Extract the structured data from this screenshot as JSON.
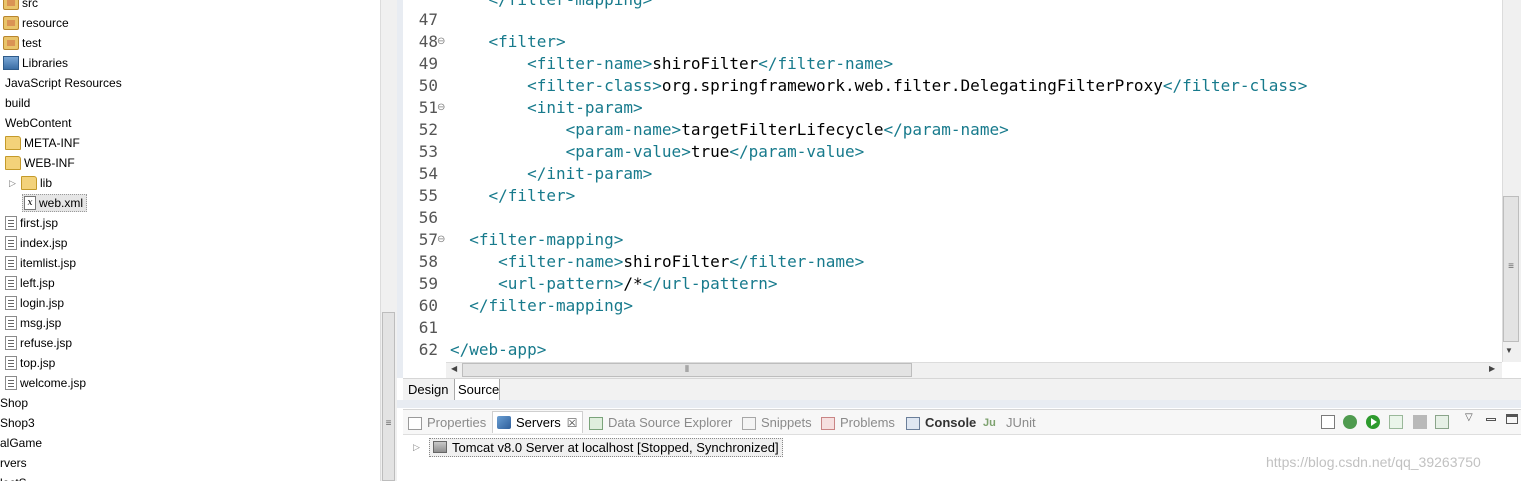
{
  "project_tree": {
    "items": [
      {
        "label": "src",
        "icon": "package-folder-icon"
      },
      {
        "label": "resource",
        "icon": "package-folder-icon"
      },
      {
        "label": "test",
        "icon": "package-folder-icon"
      },
      {
        "label": "Libraries",
        "icon": "library-icon"
      },
      {
        "label": "JavaScript Resources",
        "icon": ""
      },
      {
        "label": "build",
        "icon": ""
      },
      {
        "label": "WebContent",
        "icon": ""
      },
      {
        "label": "META-INF",
        "icon": "folder-icon"
      },
      {
        "label": "WEB-INF",
        "icon": "folder-icon"
      },
      {
        "label": "lib",
        "icon": "folder-icon"
      },
      {
        "label": "web.xml",
        "icon": "xml-file-icon"
      },
      {
        "label": "first.jsp",
        "icon": "jsp-file-icon"
      },
      {
        "label": "index.jsp",
        "icon": "jsp-file-icon"
      },
      {
        "label": "itemlist.jsp",
        "icon": "jsp-file-icon"
      },
      {
        "label": "left.jsp",
        "icon": "jsp-file-icon"
      },
      {
        "label": "login.jsp",
        "icon": "jsp-file-icon"
      },
      {
        "label": "msg.jsp",
        "icon": "jsp-file-icon"
      },
      {
        "label": "refuse.jsp",
        "icon": "jsp-file-icon"
      },
      {
        "label": "top.jsp",
        "icon": "jsp-file-icon"
      },
      {
        "label": "welcome.jsp",
        "icon": "jsp-file-icon"
      },
      {
        "label": "Shop",
        "icon": ""
      },
      {
        "label": "Shop3",
        "icon": ""
      },
      {
        "label": "alGame",
        "icon": ""
      },
      {
        "label": "rvers",
        "icon": ""
      },
      {
        "label": "lectS",
        "icon": ""
      }
    ],
    "selected": "web.xml"
  },
  "editor": {
    "top_line_text": "</filter-mapping>",
    "lines": [
      {
        "num": "47",
        "fold": "",
        "parts": []
      },
      {
        "num": "48",
        "fold": "⊖",
        "parts": [
          {
            "t": "<filter>",
            "c": "tg"
          }
        ]
      },
      {
        "num": "49",
        "fold": "",
        "parts": [
          {
            "t": "<filter-name>",
            "c": "tg"
          },
          {
            "t": "shiroFilter",
            "c": "tx"
          },
          {
            "t": "</filter-name>",
            "c": "tg"
          }
        ]
      },
      {
        "num": "50",
        "fold": "",
        "parts": [
          {
            "t": "<filter-class>",
            "c": "tg"
          },
          {
            "t": "org.springframework.web.filter.DelegatingFilterProxy",
            "c": "tx"
          },
          {
            "t": "</filter-class>",
            "c": "tg"
          }
        ]
      },
      {
        "num": "51",
        "fold": "⊖",
        "parts": [
          {
            "t": "<init-param>",
            "c": "tg"
          }
        ]
      },
      {
        "num": "52",
        "fold": "",
        "parts": [
          {
            "t": "<param-name>",
            "c": "tg"
          },
          {
            "t": "targetFilterLifecycle",
            "c": "tx"
          },
          {
            "t": "</param-name>",
            "c": "tg"
          }
        ]
      },
      {
        "num": "53",
        "fold": "",
        "parts": [
          {
            "t": "<param-value>",
            "c": "tg"
          },
          {
            "t": "true",
            "c": "tx"
          },
          {
            "t": "</param-value>",
            "c": "tg"
          }
        ]
      },
      {
        "num": "54",
        "fold": "",
        "parts": [
          {
            "t": "</init-param>",
            "c": "tg"
          }
        ]
      },
      {
        "num": "55",
        "fold": "",
        "parts": [
          {
            "t": "</filter>",
            "c": "tg"
          }
        ]
      },
      {
        "num": "56",
        "fold": "",
        "parts": []
      },
      {
        "num": "57",
        "fold": "⊖",
        "parts": [
          {
            "t": "<filter-mapping>",
            "c": "tg"
          }
        ]
      },
      {
        "num": "58",
        "fold": "",
        "parts": [
          {
            "t": "<filter-name>",
            "c": "tg"
          },
          {
            "t": "shiroFilter",
            "c": "tx"
          },
          {
            "t": "</filter-name>",
            "c": "tg"
          }
        ]
      },
      {
        "num": "59",
        "fold": "",
        "parts": [
          {
            "t": "<url-pattern>",
            "c": "tg"
          },
          {
            "t": "/*",
            "c": "tx"
          },
          {
            "t": "</url-pattern>",
            "c": "tg"
          }
        ]
      },
      {
        "num": "60",
        "fold": "",
        "parts": [
          {
            "t": "</filter-mapping>",
            "c": "tg"
          }
        ]
      },
      {
        "num": "61",
        "fold": "",
        "parts": []
      },
      {
        "num": "62",
        "fold": "",
        "parts": [
          {
            "t": "</web-app>",
            "c": "tg"
          }
        ]
      }
    ],
    "tag_color": "#177a8c"
  },
  "mode_tabs": {
    "design": "Design",
    "source": "Source",
    "active": "Source"
  },
  "views": {
    "tabs": [
      {
        "label": "Properties",
        "icon": "properties-icon"
      },
      {
        "label": "Servers",
        "icon": "servers-icon",
        "close": "☒"
      },
      {
        "label": "Data Source Explorer",
        "icon": "data-source-explorer-icon"
      },
      {
        "label": "Snippets",
        "icon": "snippets-icon"
      },
      {
        "label": "Problems",
        "icon": "problems-icon"
      },
      {
        "label": "Console",
        "icon": "console-icon"
      },
      {
        "label": "JUnit",
        "icon": "junit-icon",
        "prefix": "Ju"
      }
    ],
    "active_tab": "Servers",
    "toolbar_icons": [
      "new-server-icon",
      "debug-icon",
      "start-icon",
      "profile-icon",
      "stop-icon",
      "publish-icon"
    ],
    "server": {
      "label": "Tomcat v8.0 Server at localhost  [Stopped, Synchronized]"
    }
  },
  "watermark": "https://blog.csdn.net/qq_39263750"
}
